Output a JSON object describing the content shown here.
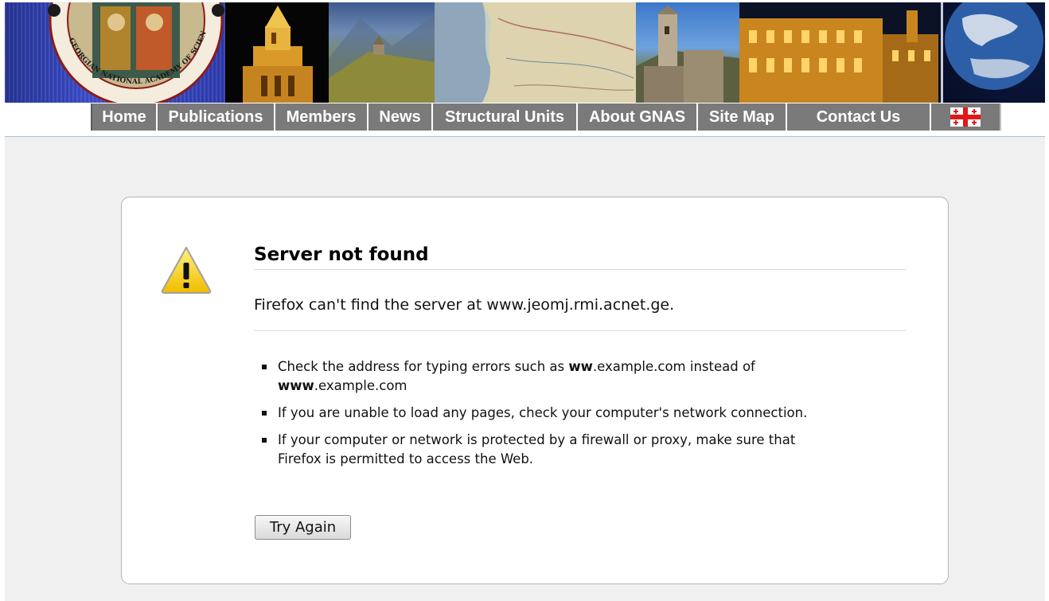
{
  "banner": {
    "seal_text": "GEORGIAN NATIONAL ACADEMY OF SCIENCES"
  },
  "nav": {
    "items": [
      {
        "label": "Home"
      },
      {
        "label": "Publications"
      },
      {
        "label": "Members"
      },
      {
        "label": "News"
      },
      {
        "label": "Structural Units"
      },
      {
        "label": "About GNAS"
      },
      {
        "label": "Site Map"
      },
      {
        "label": "Contact Us"
      }
    ],
    "flag_icon": "georgian-flag-icon"
  },
  "error": {
    "icon": "warning-icon",
    "title": "Server not found",
    "description": "Firefox can't find the server at www.jeomj.rmi.acnet.ge.",
    "hints": {
      "h1_prefix": "Check the address for typing errors such as ",
      "h1_bold1": "ww",
      "h1_mid": ".example.com instead of ",
      "h1_bold2": "www",
      "h1_suffix": ".example.com",
      "h2": "If you are unable to load any pages, check your computer's network connection.",
      "h3": "If your computer or network is protected by a firewall or proxy, make sure that Firefox is permitted to access the Web."
    },
    "button_label": "Try Again"
  },
  "colors": {
    "nav_bg": "#7a7a7a",
    "page_bg": "#f0f0f0",
    "warning_yellow": "#f2c300"
  }
}
